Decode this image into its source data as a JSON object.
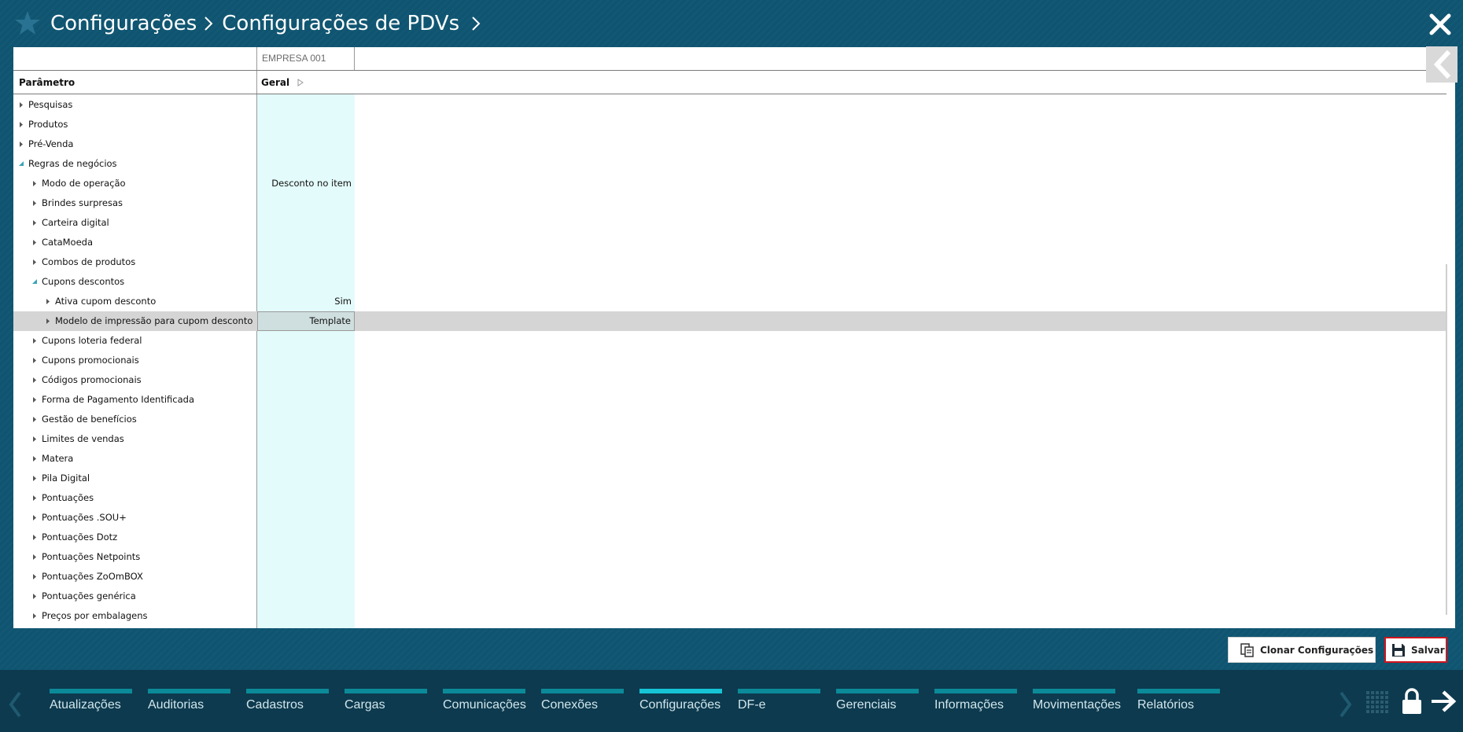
{
  "header": {
    "breadcrumb": [
      "Configurações",
      "Configurações de PDVs"
    ]
  },
  "table": {
    "company_column": "EMPRESA 001",
    "param_header": "Parâmetro",
    "group_header": "Geral",
    "rows": [
      {
        "label": "Pesquisas",
        "level": 0,
        "expanded": false,
        "value": ""
      },
      {
        "label": "Produtos",
        "level": 0,
        "expanded": false,
        "value": ""
      },
      {
        "label": "Pré-Venda",
        "level": 0,
        "expanded": false,
        "value": ""
      },
      {
        "label": "Regras de negócios",
        "level": 0,
        "expanded": true,
        "value": ""
      },
      {
        "label": "Modo de operação",
        "level": 1,
        "expanded": false,
        "value": "Desconto no item"
      },
      {
        "label": "Brindes surpresas",
        "level": 1,
        "expanded": false,
        "value": ""
      },
      {
        "label": "Carteira digital",
        "level": 1,
        "expanded": false,
        "value": ""
      },
      {
        "label": "CataMoeda",
        "level": 1,
        "expanded": false,
        "value": ""
      },
      {
        "label": "Combos de produtos",
        "level": 1,
        "expanded": false,
        "value": ""
      },
      {
        "label": "Cupons descontos",
        "level": 1,
        "expanded": true,
        "value": ""
      },
      {
        "label": "Ativa cupom desconto",
        "level": 2,
        "expanded": false,
        "value": "Sim"
      },
      {
        "label": "Modelo de impressão para cupom desconto",
        "level": 2,
        "expanded": false,
        "value": "Template",
        "selected": true
      },
      {
        "label": "Cupons loteria federal",
        "level": 1,
        "expanded": false,
        "value": ""
      },
      {
        "label": "Cupons promocionais",
        "level": 1,
        "expanded": false,
        "value": ""
      },
      {
        "label": "Códigos promocionais",
        "level": 1,
        "expanded": false,
        "value": ""
      },
      {
        "label": "Forma de Pagamento Identificada",
        "level": 1,
        "expanded": false,
        "value": ""
      },
      {
        "label": "Gestão de benefícios",
        "level": 1,
        "expanded": false,
        "value": ""
      },
      {
        "label": "Limites de vendas",
        "level": 1,
        "expanded": false,
        "value": ""
      },
      {
        "label": "Matera",
        "level": 1,
        "expanded": false,
        "value": ""
      },
      {
        "label": "Pila Digital",
        "level": 1,
        "expanded": false,
        "value": ""
      },
      {
        "label": "Pontuações",
        "level": 1,
        "expanded": false,
        "value": ""
      },
      {
        "label": "Pontuações .SOU+",
        "level": 1,
        "expanded": false,
        "value": ""
      },
      {
        "label": "Pontuações Dotz",
        "level": 1,
        "expanded": false,
        "value": ""
      },
      {
        "label": "Pontuações Netpoints",
        "level": 1,
        "expanded": false,
        "value": ""
      },
      {
        "label": "Pontuações ZoOmBOX",
        "level": 1,
        "expanded": false,
        "value": ""
      },
      {
        "label": "Pontuações genérica",
        "level": 1,
        "expanded": false,
        "value": ""
      },
      {
        "label": "Preços por embalagens",
        "level": 1,
        "expanded": false,
        "value": ""
      }
    ]
  },
  "actions": {
    "clone_label": "Clonar Configurações",
    "save_label": "Salvar"
  },
  "nav": {
    "items": [
      {
        "label": "Atualizações",
        "active": false
      },
      {
        "label": "Auditorias",
        "active": false
      },
      {
        "label": "Cadastros",
        "active": false
      },
      {
        "label": "Cargas",
        "active": false
      },
      {
        "label": "Comunicações",
        "active": false
      },
      {
        "label": "Conexões",
        "active": false
      },
      {
        "label": "Configurações",
        "active": true
      },
      {
        "label": "DF-e",
        "active": false
      },
      {
        "label": "Gerenciais",
        "active": false
      },
      {
        "label": "Informações",
        "active": false
      },
      {
        "label": "Movimentações",
        "active": false
      },
      {
        "label": "Relatórios",
        "active": false
      }
    ]
  },
  "colors": {
    "background": "#0f5571",
    "nav_background": "#0d3a4e",
    "highlight_column": "#e3fbfa",
    "selected_row": "#d5d5d5",
    "nav_bar": "#0b8a99",
    "nav_bar_active": "#16c4d6",
    "save_outline": "#d0141c",
    "triangle": "#3aa3b8"
  },
  "icons": {
    "header": "star-icon",
    "close": "close-icon",
    "collapse": "chevron-left-icon",
    "clone": "clone-icon",
    "save": "floppy-disk-icon",
    "grid": "grid-icon",
    "lock": "lock-icon",
    "logout": "arrow-right-icon"
  }
}
